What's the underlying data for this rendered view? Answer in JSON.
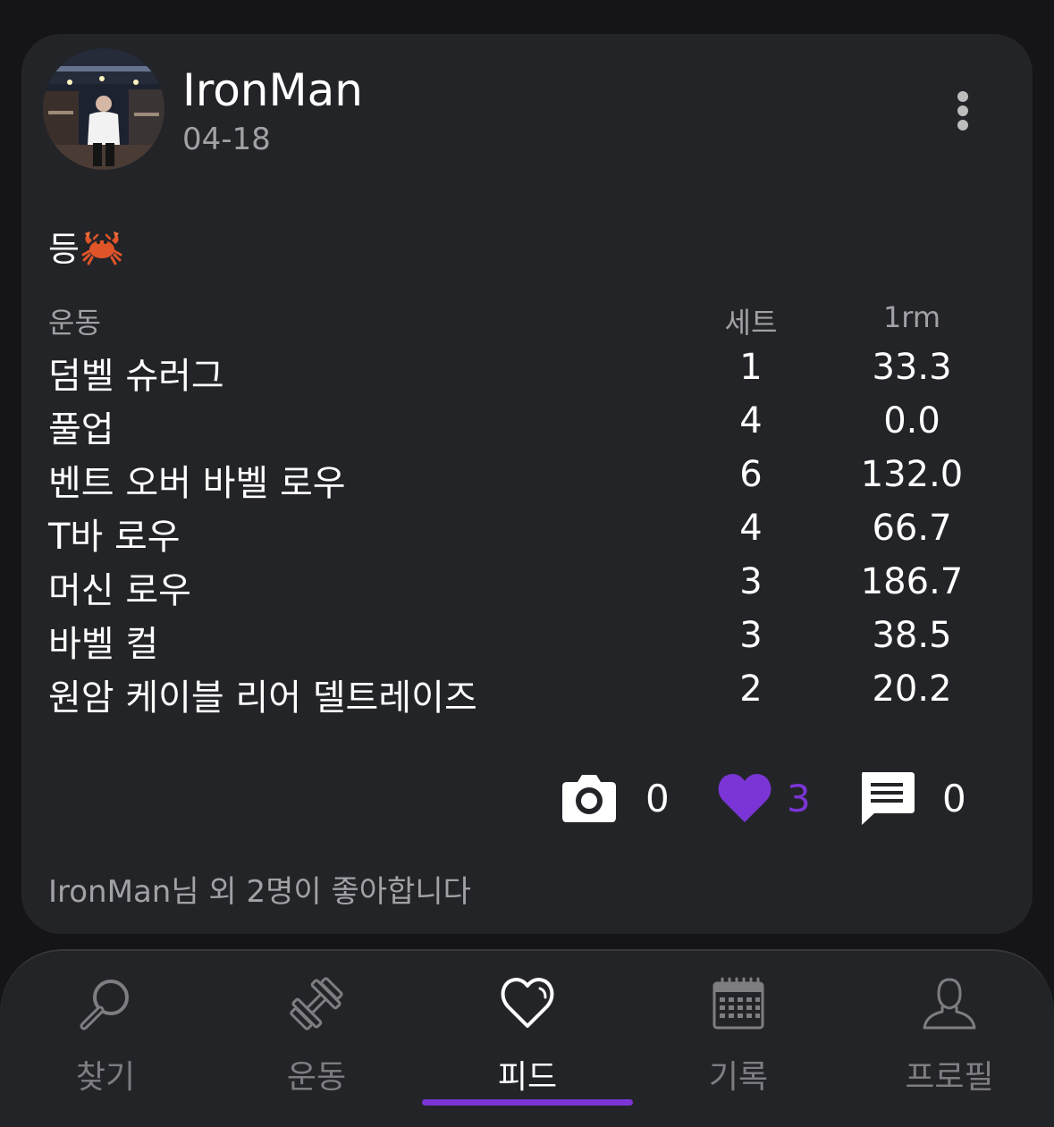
{
  "post": {
    "username": "IronMan",
    "date": "04-18",
    "title": "등",
    "title_emoji_icon": "crab-icon",
    "menu_icon": "more-vertical-icon"
  },
  "workout_table": {
    "headers": {
      "exercise": "운동",
      "sets": "세트",
      "one_rm": "1rm"
    },
    "rows": [
      {
        "exercise": "덤벨 슈러그",
        "sets": "1",
        "one_rm": "33.3"
      },
      {
        "exercise": "풀업",
        "sets": "4",
        "one_rm": "0.0"
      },
      {
        "exercise": "벤트 오버 바벨 로우",
        "sets": "6",
        "one_rm": "132.0"
      },
      {
        "exercise": "T바 로우",
        "sets": "4",
        "one_rm": "66.7"
      },
      {
        "exercise": "머신 로우",
        "sets": "3",
        "one_rm": "186.7"
      },
      {
        "exercise": "바벨 컬",
        "sets": "3",
        "one_rm": "38.5"
      },
      {
        "exercise": "원암 케이블 리어 델트레이즈",
        "sets": "2",
        "one_rm": "20.2"
      }
    ]
  },
  "actions": {
    "photos": {
      "icon": "camera-icon",
      "count": "0"
    },
    "likes": {
      "icon": "heart-filled-icon",
      "count": "3"
    },
    "comments": {
      "icon": "comment-icon",
      "count": "0"
    }
  },
  "likes_summary": "IronMan님 외 2명이 좋아합니다",
  "tab_bar": {
    "tabs": [
      {
        "label": "찾기",
        "icon": "search-icon"
      },
      {
        "label": "운동",
        "icon": "dumbbell-icon"
      },
      {
        "label": "피드",
        "icon": "heart-outline-icon"
      },
      {
        "label": "기록",
        "icon": "calendar-icon"
      },
      {
        "label": "프로필",
        "icon": "user-icon"
      }
    ],
    "active": "피드"
  },
  "colors": {
    "background": "#151518",
    "card": "#232428",
    "accent_purple": "#7b35d6",
    "muted_text": "#a1a1a6",
    "inactive_tab": "#7d7d82"
  }
}
